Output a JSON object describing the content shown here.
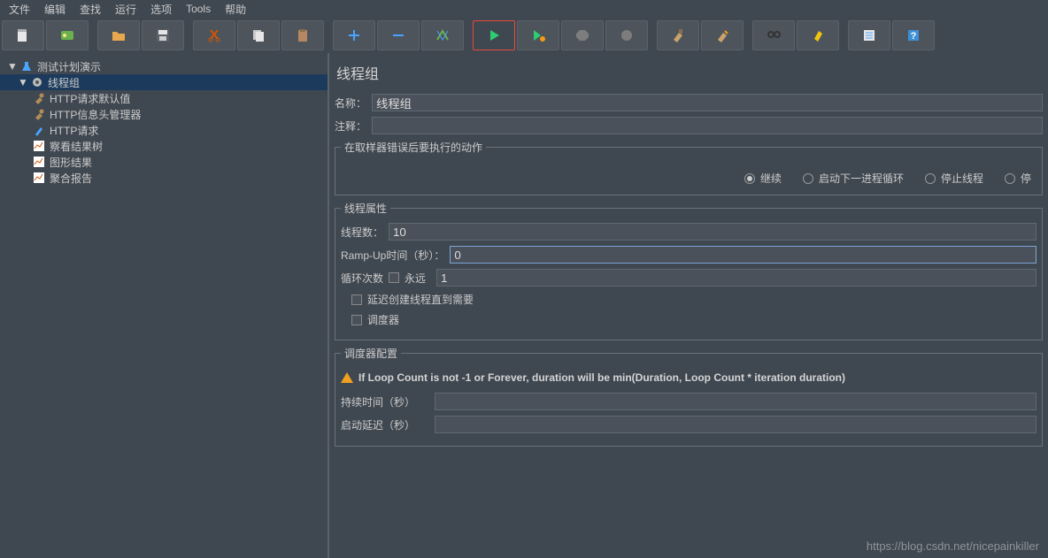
{
  "menu": [
    "文件",
    "编辑",
    "查找",
    "运行",
    "选项",
    "Tools",
    "帮助"
  ],
  "tree": {
    "root": "测试计划演示",
    "group": "线程组",
    "items": [
      "HTTP请求默认值",
      "HTTP信息头管理器",
      "HTTP请求",
      "察看结果树",
      "图形结果",
      "聚合报告"
    ]
  },
  "panel": {
    "title": "线程组",
    "name_label": "名称：",
    "name_value": "线程组",
    "comment_label": "注释：",
    "onerror_legend": "在取样器错误后要执行的动作",
    "radio_cont": "继续",
    "radio_next": "启动下一进程循环",
    "radio_stopth": "停止线程",
    "radio_stop": "停",
    "props_legend": "线程属性",
    "threads_label": "线程数：",
    "threads_value": "10",
    "ramp_label": "Ramp-Up时间（秒）：",
    "ramp_value": "0",
    "loop_label": "循环次数",
    "forever_label": "永远",
    "loop_value": "1",
    "delay_create": "延迟创建线程直到需要",
    "scheduler": "调度器",
    "sched_legend": "调度器配置",
    "sched_warn": "If Loop Count is not -1 or Forever, duration will be min(Duration, Loop Count * iteration duration)",
    "duration_label": "持续时间（秒）",
    "startdelay_label": "启动延迟（秒）"
  },
  "watermark": "https://blog.csdn.net/nicepainkiller"
}
